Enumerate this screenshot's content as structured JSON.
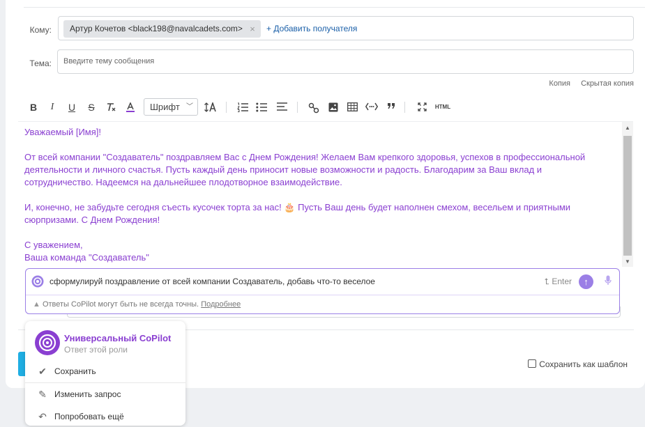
{
  "compose": {
    "to_label": "Кому:",
    "recipient": "Артур Кочетов <black198@navalcadets.com>",
    "recipient_remove": "×",
    "add_recipient": "+ Добавить получателя",
    "subject_label": "Тема:",
    "subject_placeholder": "Введите тему сообщения",
    "cc_link": "Копия",
    "bcc_link": "Скрытая копия"
  },
  "toolbar": {
    "bold": "B",
    "italic": "I",
    "underline": "U",
    "strike": "S",
    "font_label": "Шрифт",
    "html_label": "HTML"
  },
  "editor": {
    "lines": [
      "Уважаемый [Имя]!",
      "",
      "От всей компании \"Создаватель\" поздравляем Вас с Днем Рождения! Желаем Вам крепкого здоровья, успехов в профессиональной деятельности и личного счастья. Пусть каждый день приносит новые возможности и радость. Благодарим за Ваш вклад и сотрудничество. Надеемся на дальнейшее плодотворное взаимодействие.",
      "",
      "И, конечно, не забудьте сегодня съесть кусочек торта за нас! 🎂 Пусть Ваш день будет наполнен смехом, весельем и приятными сюрпризами. С Днем Рождения!",
      "",
      "С уважением,",
      "Ваша команда \"Создаватель\""
    ],
    "text_color": "#8a3fd1"
  },
  "copilot": {
    "prompt": "сформулируй поздравление от всей компании Создаватель, добавь что-то веселое",
    "enter_hint": "Enter",
    "disclaimer": "Ответы CoPilot могут быть не всегда точны.",
    "more_link": "Подробнее",
    "accent": "#9b7fe6"
  },
  "menu": {
    "title": "Универсальный CoPilot",
    "subtitle": "Ответ этой роли",
    "items": [
      {
        "label": "Сохранить",
        "icon": "check-icon"
      },
      {
        "label": "Изменить запрос",
        "icon": "pencil-icon"
      },
      {
        "label": "Попробовать ещё",
        "icon": "retry-icon"
      }
    ]
  },
  "footer": {
    "save_template": "Сохранить как шаблон"
  }
}
